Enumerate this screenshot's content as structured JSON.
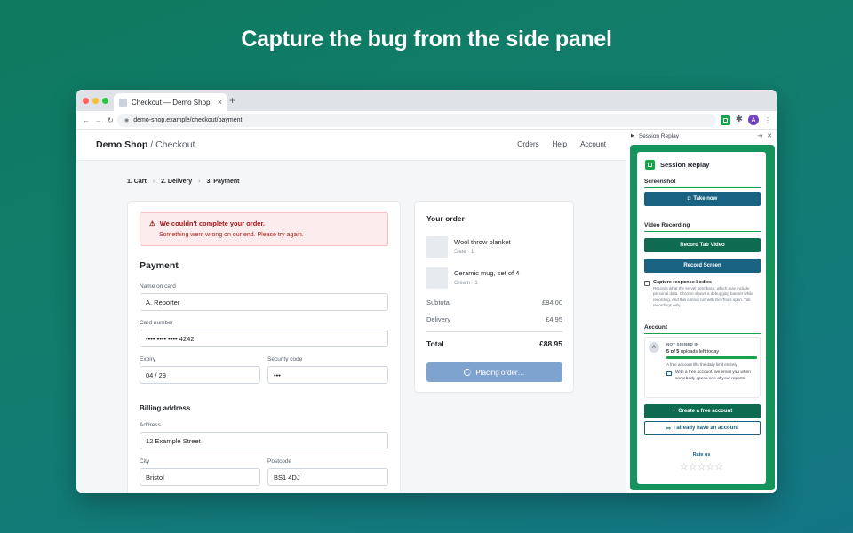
{
  "headline": "Capture the bug from the side panel",
  "browser": {
    "tab_title": "Checkout — Demo Shop",
    "url": "demo-shop.example/checkout/payment",
    "avatar_letter": "A"
  },
  "site": {
    "brand": "Demo Shop",
    "brand_sub": " / Checkout",
    "nav": [
      "Orders",
      "Help",
      "Account"
    ]
  },
  "steps": [
    "1. Cart",
    "2. Delivery",
    "3. Payment"
  ],
  "alert": {
    "title": "We couldn't complete your order.",
    "desc": "Something went wrong on our end. Please try again."
  },
  "payment": {
    "heading": "Payment",
    "name_label": "Name on card",
    "name_value": "A. Reporter",
    "card_label": "Card number",
    "card_value": "•••• •••• •••• 4242",
    "expiry_label": "Expiry",
    "expiry_value": "04 / 29",
    "cvc_label": "Security code",
    "cvc_value": "•••"
  },
  "billing": {
    "heading": "Billing address",
    "address_label": "Address",
    "address_value": "12 Example Street",
    "city_label": "City",
    "city_value": "Bristol",
    "postcode_label": "Postcode",
    "postcode_value": "BS1 4DJ"
  },
  "order": {
    "title": "Your order",
    "items": [
      {
        "name": "Wool throw blanket",
        "meta": "Slate · 1"
      },
      {
        "name": "Ceramic mug, set of 4",
        "meta": "Cream · 1"
      }
    ],
    "subtotal_label": "Subtotal",
    "subtotal_value": "£84.00",
    "delivery_label": "Delivery",
    "delivery_value": "£4.95",
    "total_label": "Total",
    "total_value": "£88.95",
    "button_label": "Placing order…"
  },
  "panel": {
    "header": "Session Replay",
    "brand": "Session Replay",
    "screenshot_heading": "Screenshot",
    "take_now": "Take now",
    "video_heading": "Video Recording",
    "record_tab": "Record Tab Video",
    "record_screen": "Record Screen",
    "capture_label": "Capture response bodies",
    "capture_desc": "Records what the server sent back, which may include personal data. Chrome shows a debugging banner while recording, and this cannot run with DevTools open. Tab recordings only.",
    "account_heading": "Account",
    "account_avatar": "A",
    "not_signed_in": "NOT SIGNED IN",
    "uploads_count": "5 of 5",
    "uploads_text": " uploads left today",
    "uploads_remaining_fraction": 1.0,
    "account_note": "A free account lifts the daily limit entirely",
    "mail_text": "With a free account, we email you when somebody opens one of your reports.",
    "create_account": "Create a free account",
    "have_account": "I already have an account",
    "rate_us": "Rate us",
    "stars": "☆☆☆☆☆"
  },
  "colors": {
    "accent_green": "#16a34a",
    "button_blue": "#1a6281",
    "button_green": "#0e6b4f",
    "error_red": "#a4161a"
  }
}
